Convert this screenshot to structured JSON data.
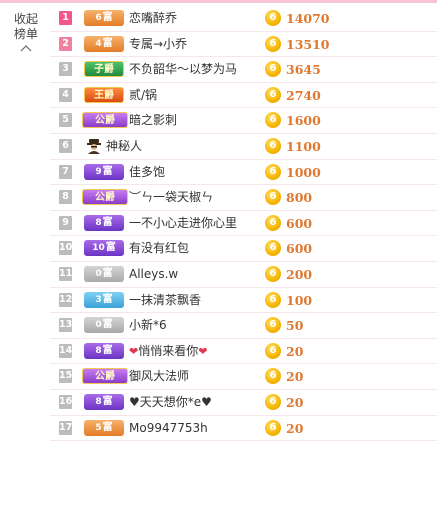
{
  "collapse": {
    "line1": "收起",
    "line2": "榜单"
  },
  "coin_symbol": "6",
  "colors": {
    "accent": "#e0782f",
    "rank_top": "#f3558e",
    "rank_second": "#f0829f",
    "rank_default": "#bcbcbc"
  },
  "rows": [
    {
      "rank": "1",
      "badge_num": "6",
      "badge_text": "富",
      "badge_style": "fu",
      "name": "恋嘴醉乔",
      "score": "14070"
    },
    {
      "rank": "2",
      "badge_num": "4",
      "badge_text": "富",
      "badge_style": "fu",
      "name": "专属→小乔",
      "score": "13510"
    },
    {
      "rank": "3",
      "badge_num": "",
      "badge_text": "子爵",
      "badge_style": "zijue",
      "name": "不负韶华～以梦为马",
      "score": "3645"
    },
    {
      "rank": "4",
      "badge_num": "",
      "badge_text": "王爵",
      "badge_style": "wangjue",
      "name": "贰/锅",
      "score": "2740"
    },
    {
      "rank": "5",
      "badge_num": "",
      "badge_text": "公爵",
      "badge_style": "gongjue",
      "name": "暗之影刺",
      "score": "1600"
    },
    {
      "rank": "6",
      "badge_num": "",
      "badge_text": "",
      "badge_style": "mystery",
      "name": "神秘人",
      "score": "1100",
      "icon": "mystery-person-icon"
    },
    {
      "rank": "7",
      "badge_num": "9",
      "badge_text": "富",
      "badge_style": "fu-pur",
      "name": "佳多饱",
      "score": "1000"
    },
    {
      "rank": "8",
      "badge_num": "",
      "badge_text": "公爵",
      "badge_style": "gongjue",
      "name": "︶ㄣ一袋天椒ㄣ",
      "score": "800"
    },
    {
      "rank": "9",
      "badge_num": "8",
      "badge_text": "富",
      "badge_style": "fu-pur",
      "name": "一不小心走进你心里",
      "score": "600"
    },
    {
      "rank": "10",
      "badge_num": "10",
      "badge_text": "富",
      "badge_style": "fu-pur",
      "name": "有没有红包",
      "score": "600"
    },
    {
      "rank": "11",
      "badge_num": "0",
      "badge_text": "富",
      "badge_style": "fu-grey",
      "name": "Alleys.w",
      "score": "200"
    },
    {
      "rank": "12",
      "badge_num": "3",
      "badge_text": "富",
      "badge_style": "fu-blue",
      "name": "一抹清茶飘香",
      "score": "100"
    },
    {
      "rank": "13",
      "badge_num": "0",
      "badge_text": "富",
      "badge_style": "fu-grey",
      "name": "小新*6",
      "score": "50"
    },
    {
      "rank": "14",
      "badge_num": "8",
      "badge_text": "富",
      "badge_style": "fu-pur",
      "name": "悄悄来看你",
      "score": "20",
      "hearts": true
    },
    {
      "rank": "15",
      "badge_num": "",
      "badge_text": "公爵",
      "badge_style": "gongjue",
      "name": "御风大法师",
      "score": "20"
    },
    {
      "rank": "16",
      "badge_num": "8",
      "badge_text": "富",
      "badge_style": "fu-pur",
      "name": "♥天天想你*e♥",
      "score": "20"
    },
    {
      "rank": "17",
      "badge_num": "5",
      "badge_text": "富",
      "badge_style": "fu",
      "name": "Mo9947753h",
      "score": "20"
    }
  ]
}
